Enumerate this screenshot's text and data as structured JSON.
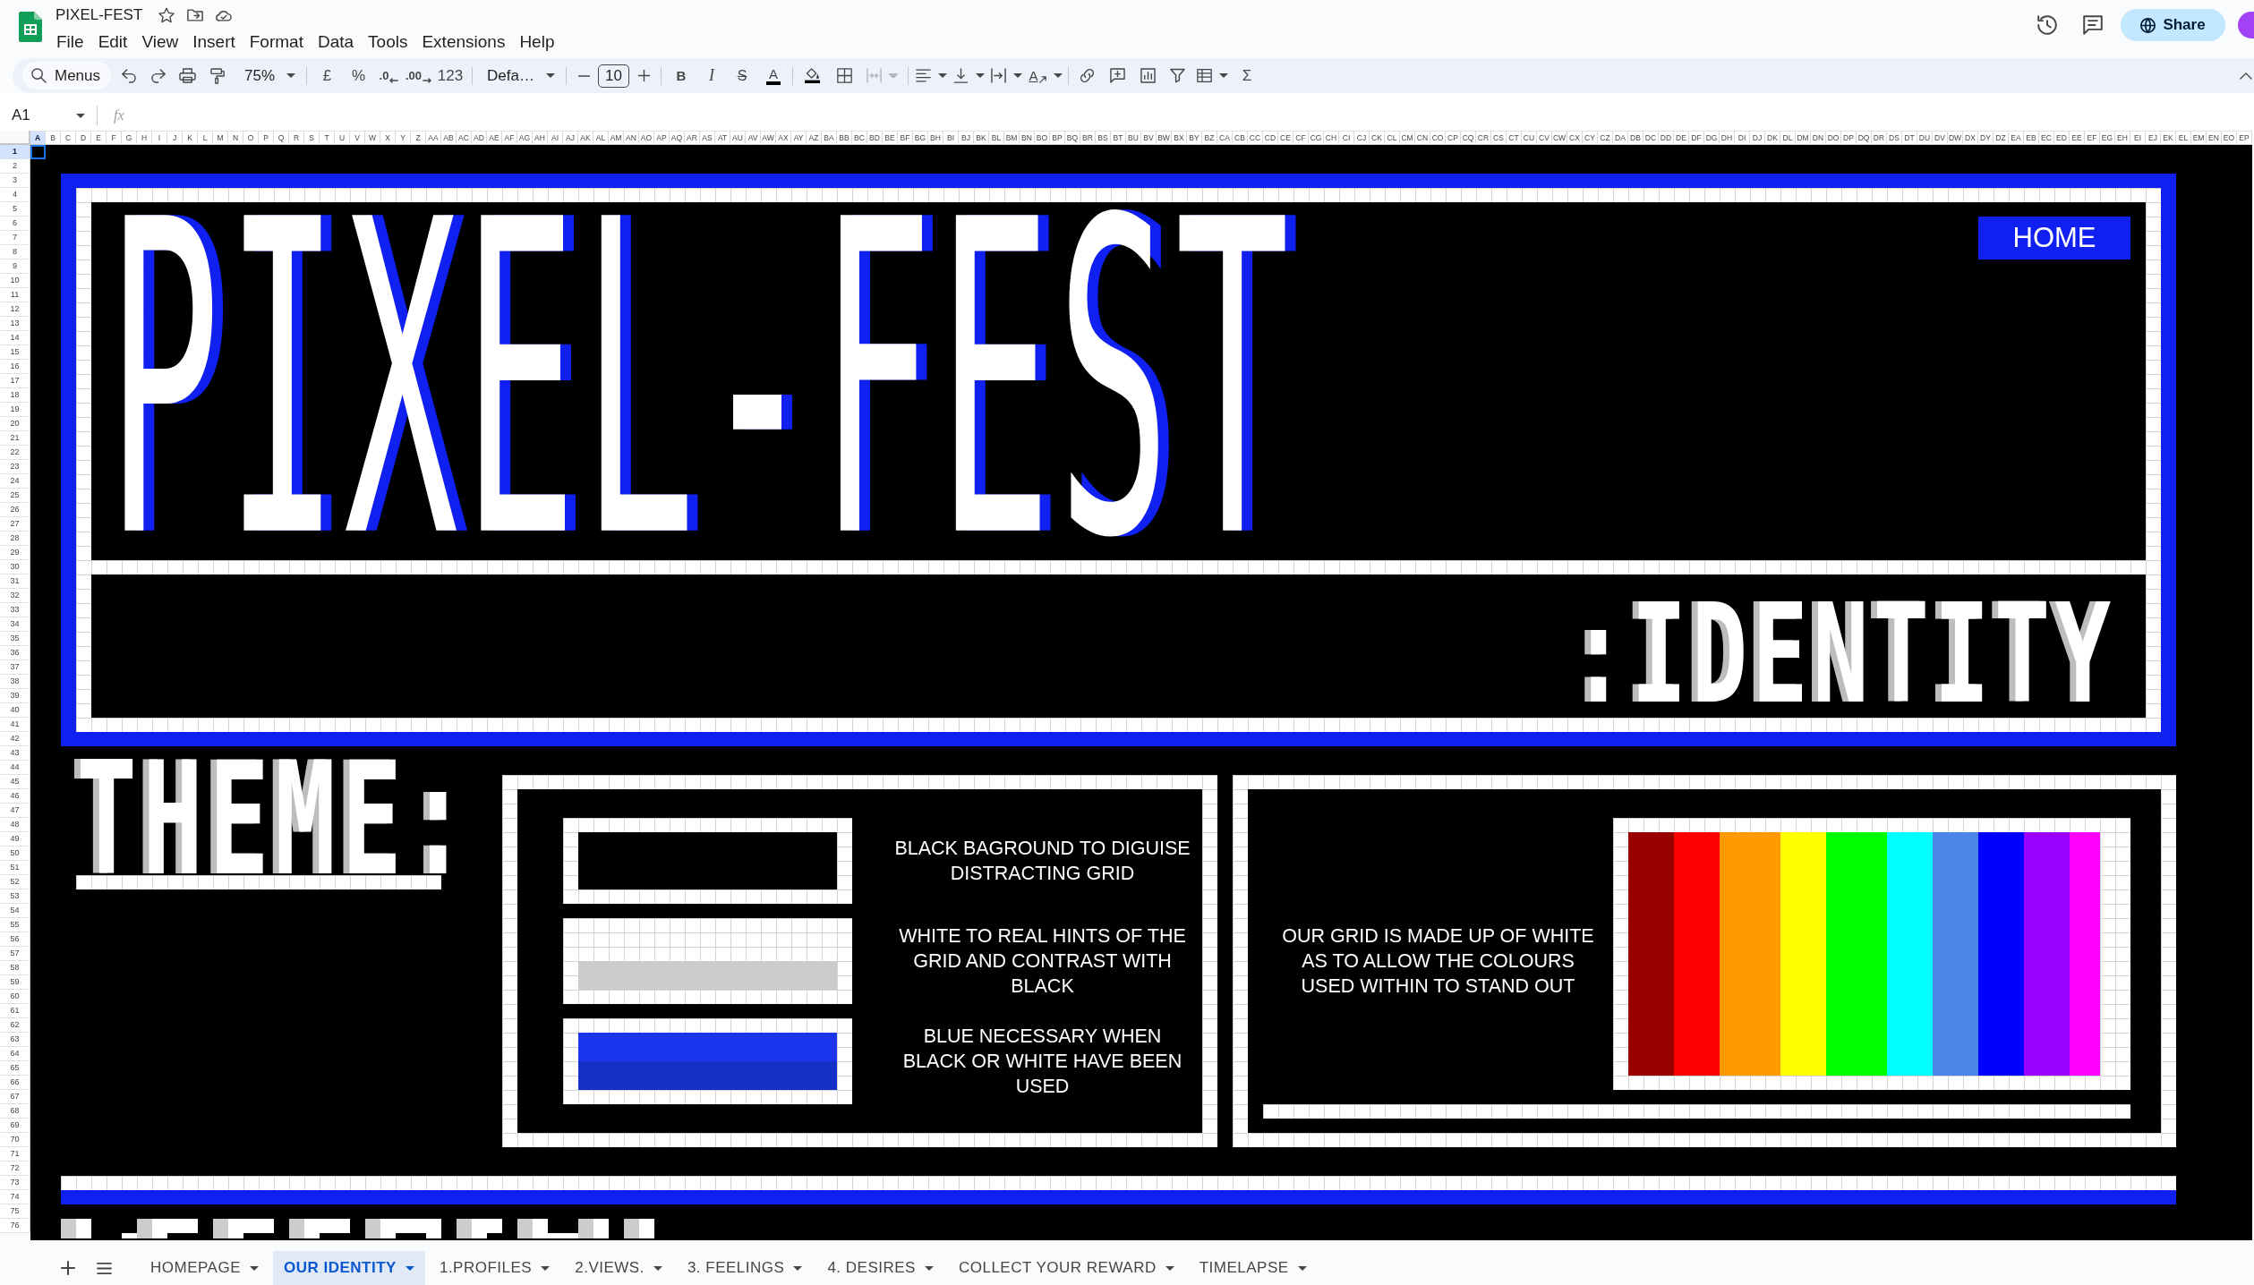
{
  "app": {
    "title": "PIXEL-FEST",
    "menus": [
      "File",
      "Edit",
      "View",
      "Insert",
      "Format",
      "Data",
      "Tools",
      "Extensions",
      "Help"
    ],
    "share": "Share"
  },
  "toolbar": {
    "search_label": "Menus",
    "zoom": "75%",
    "currency": "£",
    "percent": "%",
    "decrease_decimal": ".0",
    "increase_decimal": ".00",
    "number_format": "123",
    "font": "Defa…",
    "font_size": "10",
    "bold": "B",
    "italic": "I",
    "strikethrough": "S",
    "text_color": "A",
    "merge": {
      "disabled": true
    },
    "text_rotation": "A",
    "functions": "Σ"
  },
  "formula_bar": {
    "name_box": "A1",
    "function_label": "fx"
  },
  "columns": [
    {
      "label": "A",
      "selected": true
    },
    {
      "label": "B",
      "selected": false
    },
    {
      "label": "C",
      "selected": false
    },
    {
      "label": "D",
      "selected": false
    },
    {
      "label": "E",
      "selected": false
    },
    {
      "label": "F",
      "selected": false
    },
    {
      "label": "G",
      "selected": false
    },
    {
      "label": "H",
      "selected": false
    },
    {
      "label": "I",
      "selected": false
    },
    {
      "label": "J",
      "selected": false
    },
    {
      "label": "K",
      "selected": false
    },
    {
      "label": "L",
      "selected": false
    },
    {
      "label": "M",
      "selected": false
    },
    {
      "label": "N",
      "selected": false
    },
    {
      "label": "O",
      "selected": false
    },
    {
      "label": "P",
      "selected": false
    },
    {
      "label": "Q",
      "selected": false
    },
    {
      "label": "R",
      "selected": false
    },
    {
      "label": "S",
      "selected": false
    },
    {
      "label": "T",
      "selected": false
    },
    {
      "label": "U",
      "selected": false
    },
    {
      "label": "V",
      "selected": false
    },
    {
      "label": "W",
      "selected": false
    },
    {
      "label": "X",
      "selected": false
    },
    {
      "label": "Y",
      "selected": false
    },
    {
      "label": "Z",
      "selected": false
    },
    {
      "label": "AA",
      "selected": false
    },
    {
      "label": "AB",
      "selected": false
    },
    {
      "label": "AC",
      "selected": false
    },
    {
      "label": "AD",
      "selected": false
    },
    {
      "label": "AE",
      "selected": false
    },
    {
      "label": "AF",
      "selected": false
    },
    {
      "label": "AG",
      "selected": false
    },
    {
      "label": "AH",
      "selected": false
    },
    {
      "label": "AI",
      "selected": false
    },
    {
      "label": "AJ",
      "selected": false
    },
    {
      "label": "AK",
      "selected": false
    },
    {
      "label": "AL",
      "selected": false
    },
    {
      "label": "AM",
      "selected": false
    },
    {
      "label": "AN",
      "selected": false
    },
    {
      "label": "AO",
      "selected": false
    },
    {
      "label": "AP",
      "selected": false
    },
    {
      "label": "AQ",
      "selected": false
    },
    {
      "label": "AR",
      "selected": false
    },
    {
      "label": "AS",
      "selected": false
    },
    {
      "label": "AT",
      "selected": false
    },
    {
      "label": "AU",
      "selected": false
    },
    {
      "label": "AV",
      "selected": false
    },
    {
      "label": "AW",
      "selected": false
    },
    {
      "label": "AX",
      "selected": false
    },
    {
      "label": "AY",
      "selected": false
    },
    {
      "label": "AZ",
      "selected": false
    },
    {
      "label": "BA",
      "selected": false
    },
    {
      "label": "BB",
      "selected": false
    },
    {
      "label": "BC",
      "selected": false
    },
    {
      "label": "BD",
      "selected": false
    },
    {
      "label": "BE",
      "selected": false
    },
    {
      "label": "BF",
      "selected": false
    },
    {
      "label": "BG",
      "selected": false
    },
    {
      "label": "BH",
      "selected": false
    },
    {
      "label": "BI",
      "selected": false
    },
    {
      "label": "BJ",
      "selected": false
    },
    {
      "label": "BK",
      "selected": false
    },
    {
      "label": "BL",
      "selected": false
    },
    {
      "label": "BM",
      "selected": false
    },
    {
      "label": "BN",
      "selected": false
    },
    {
      "label": "BO",
      "selected": false
    },
    {
      "label": "BP",
      "selected": false
    },
    {
      "label": "BQ",
      "selected": false
    },
    {
      "label": "BR",
      "selected": false
    },
    {
      "label": "BS",
      "selected": false
    },
    {
      "label": "BT",
      "selected": false
    },
    {
      "label": "BU",
      "selected": false
    },
    {
      "label": "BV",
      "selected": false
    },
    {
      "label": "BW",
      "selected": false
    },
    {
      "label": "BX",
      "selected": false
    },
    {
      "label": "BY",
      "selected": false
    },
    {
      "label": "BZ",
      "selected": false
    },
    {
      "label": "CA",
      "selected": false
    },
    {
      "label": "CB",
      "selected": false
    },
    {
      "label": "CC",
      "selected": false
    },
    {
      "label": "CD",
      "selected": false
    },
    {
      "label": "CE",
      "selected": false
    },
    {
      "label": "CF",
      "selected": false
    },
    {
      "label": "CG",
      "selected": false
    },
    {
      "label": "CH",
      "selected": false
    },
    {
      "label": "CI",
      "selected": false
    },
    {
      "label": "CJ",
      "selected": false
    },
    {
      "label": "CK",
      "selected": false
    },
    {
      "label": "CL",
      "selected": false
    },
    {
      "label": "CM",
      "selected": false
    },
    {
      "label": "CN",
      "selected": false
    },
    {
      "label": "CO",
      "selected": false
    },
    {
      "label": "CP",
      "selected": false
    },
    {
      "label": "CQ",
      "selected": false
    },
    {
      "label": "CR",
      "selected": false
    },
    {
      "label": "CS",
      "selected": false
    },
    {
      "label": "CT",
      "selected": false
    },
    {
      "label": "CU",
      "selected": false
    },
    {
      "label": "CV",
      "selected": false
    },
    {
      "label": "CW",
      "selected": false
    },
    {
      "label": "CX",
      "selected": false
    },
    {
      "label": "CY",
      "selected": false
    },
    {
      "label": "CZ",
      "selected": false
    },
    {
      "label": "DA",
      "selected": false
    },
    {
      "label": "DB",
      "selected": false
    },
    {
      "label": "DC",
      "selected": false
    },
    {
      "label": "DD",
      "selected": false
    },
    {
      "label": "DE",
      "selected": false
    },
    {
      "label": "DF",
      "selected": false
    },
    {
      "label": "DG",
      "selected": false
    },
    {
      "label": "DH",
      "selected": false
    },
    {
      "label": "DI",
      "selected": false
    },
    {
      "label": "DJ",
      "selected": false
    },
    {
      "label": "DK",
      "selected": false
    },
    {
      "label": "DL",
      "selected": false
    },
    {
      "label": "DM",
      "selected": false
    },
    {
      "label": "DN",
      "selected": false
    },
    {
      "label": "DO",
      "selected": false
    },
    {
      "label": "DP",
      "selected": false
    },
    {
      "label": "DQ",
      "selected": false
    },
    {
      "label": "DR",
      "selected": false
    },
    {
      "label": "DS",
      "selected": false
    },
    {
      "label": "DT",
      "selected": false
    },
    {
      "label": "DU",
      "selected": false
    },
    {
      "label": "DV",
      "selected": false
    },
    {
      "label": "DW",
      "selected": false
    },
    {
      "label": "DX",
      "selected": false
    },
    {
      "label": "DY",
      "selected": false
    },
    {
      "label": "DZ",
      "selected": false
    },
    {
      "label": "EA",
      "selected": false
    },
    {
      "label": "EB",
      "selected": false
    },
    {
      "label": "EC",
      "selected": false
    },
    {
      "label": "ED",
      "selected": false
    },
    {
      "label": "EE",
      "selected": false
    },
    {
      "label": "EF",
      "selected": false
    },
    {
      "label": "EG",
      "selected": false
    },
    {
      "label": "EH",
      "selected": false
    },
    {
      "label": "EI",
      "selected": false
    },
    {
      "label": "EJ",
      "selected": false
    },
    {
      "label": "EK",
      "selected": false
    },
    {
      "label": "EL",
      "selected": false
    },
    {
      "label": "EM",
      "selected": false
    },
    {
      "label": "EN",
      "selected": false
    },
    {
      "label": "EO",
      "selected": false
    },
    {
      "label": "EP",
      "selected": false
    }
  ],
  "rows": [
    {
      "label": "1",
      "selected": true
    },
    {
      "label": "2",
      "selected": false
    },
    {
      "label": "3",
      "selected": false
    },
    {
      "label": "4",
      "selected": false
    },
    {
      "label": "5",
      "selected": false
    },
    {
      "label": "6",
      "selected": false
    },
    {
      "label": "7",
      "selected": false
    },
    {
      "label": "8",
      "selected": false
    },
    {
      "label": "9",
      "selected": false
    },
    {
      "label": "10",
      "selected": false
    },
    {
      "label": "11",
      "selected": false
    },
    {
      "label": "12",
      "selected": false
    },
    {
      "label": "13",
      "selected": false
    },
    {
      "label": "14",
      "selected": false
    },
    {
      "label": "15",
      "selected": false
    },
    {
      "label": "16",
      "selected": false
    },
    {
      "label": "17",
      "selected": false
    },
    {
      "label": "18",
      "selected": false
    },
    {
      "label": "19",
      "selected": false
    },
    {
      "label": "20",
      "selected": false
    },
    {
      "label": "21",
      "selected": false
    },
    {
      "label": "22",
      "selected": false
    },
    {
      "label": "23",
      "selected": false
    },
    {
      "label": "24",
      "selected": false
    },
    {
      "label": "25",
      "selected": false
    },
    {
      "label": "26",
      "selected": false
    },
    {
      "label": "27",
      "selected": false
    },
    {
      "label": "28",
      "selected": false
    },
    {
      "label": "29",
      "selected": false
    },
    {
      "label": "30",
      "selected": false
    },
    {
      "label": "31",
      "selected": false
    },
    {
      "label": "32",
      "selected": false
    },
    {
      "label": "33",
      "selected": false
    },
    {
      "label": "34",
      "selected": false
    },
    {
      "label": "35",
      "selected": false
    },
    {
      "label": "36",
      "selected": false
    },
    {
      "label": "37",
      "selected": false
    },
    {
      "label": "38",
      "selected": false
    },
    {
      "label": "39",
      "selected": false
    },
    {
      "label": "40",
      "selected": false
    },
    {
      "label": "41",
      "selected": false
    },
    {
      "label": "42",
      "selected": false
    },
    {
      "label": "43",
      "selected": false
    },
    {
      "label": "44",
      "selected": false
    },
    {
      "label": "45",
      "selected": false
    },
    {
      "label": "46",
      "selected": false
    },
    {
      "label": "47",
      "selected": false
    },
    {
      "label": "48",
      "selected": false
    },
    {
      "label": "49",
      "selected": false
    },
    {
      "label": "50",
      "selected": false
    },
    {
      "label": "51",
      "selected": false
    },
    {
      "label": "52",
      "selected": false
    },
    {
      "label": "53",
      "selected": false
    },
    {
      "label": "54",
      "selected": false
    },
    {
      "label": "55",
      "selected": false
    },
    {
      "label": "56",
      "selected": false
    },
    {
      "label": "57",
      "selected": false
    },
    {
      "label": "58",
      "selected": false
    },
    {
      "label": "59",
      "selected": false
    },
    {
      "label": "60",
      "selected": false
    },
    {
      "label": "61",
      "selected": false
    },
    {
      "label": "62",
      "selected": false
    },
    {
      "label": "63",
      "selected": false
    },
    {
      "label": "64",
      "selected": false
    },
    {
      "label": "65",
      "selected": false
    },
    {
      "label": "66",
      "selected": false
    },
    {
      "label": "67",
      "selected": false
    },
    {
      "label": "68",
      "selected": false
    },
    {
      "label": "69",
      "selected": false
    },
    {
      "label": "70",
      "selected": false
    },
    {
      "label": "71",
      "selected": false
    },
    {
      "label": "72",
      "selected": false
    },
    {
      "label": "73",
      "selected": false
    },
    {
      "label": "74",
      "selected": false
    },
    {
      "label": "75",
      "selected": false
    },
    {
      "label": "76",
      "selected": false
    }
  ],
  "sheet": {
    "home_button": "HOME",
    "title_art": "PIXEL-FEST",
    "subtitle_art": ":IDENTITY",
    "theme_heading": "THEME:",
    "swatches": [
      {
        "kind": "black",
        "caption": "BLACK BAGROUND TO DIGUISE DISTRACTING GRID"
      },
      {
        "kind": "white",
        "caption": "WHITE TO REAL HINTS OF THE GRID AND CONTRAST WITH BLACK"
      },
      {
        "kind": "blue",
        "caption": "BLUE NECESSARY WHEN BLACK OR WHITE HAVE BEEN USED"
      }
    ],
    "grid_note": "OUR GRID IS MADE UP OF WHITE AS TO ALLOW THE COLOURS USED WITHIN TO STAND OUT",
    "palette": [
      {
        "color": "#980000"
      },
      {
        "color": "#ff0000"
      },
      {
        "color": "#ff9900"
      },
      {
        "color": "#ffff00"
      },
      {
        "color": "#00ff00"
      },
      {
        "color": "#00ffff"
      },
      {
        "color": "#4a86e8"
      },
      {
        "color": "#0000ff"
      },
      {
        "color": "#9900ff"
      },
      {
        "color": "#ff00ff"
      }
    ]
  },
  "sheet_tabs": [
    {
      "label": "HOMEPAGE",
      "selected": false
    },
    {
      "label": "OUR IDENTITY",
      "selected": true
    },
    {
      "label": "1.PROFILES",
      "selected": false
    },
    {
      "label": "2.VIEWS.",
      "selected": false
    },
    {
      "label": "3. FEELINGS",
      "selected": false
    },
    {
      "label": "4. DESIRES",
      "selected": false
    },
    {
      "label": "COLLECT YOUR REWARD",
      "selected": false
    },
    {
      "label": "TIMELAPSE",
      "selected": false
    }
  ]
}
